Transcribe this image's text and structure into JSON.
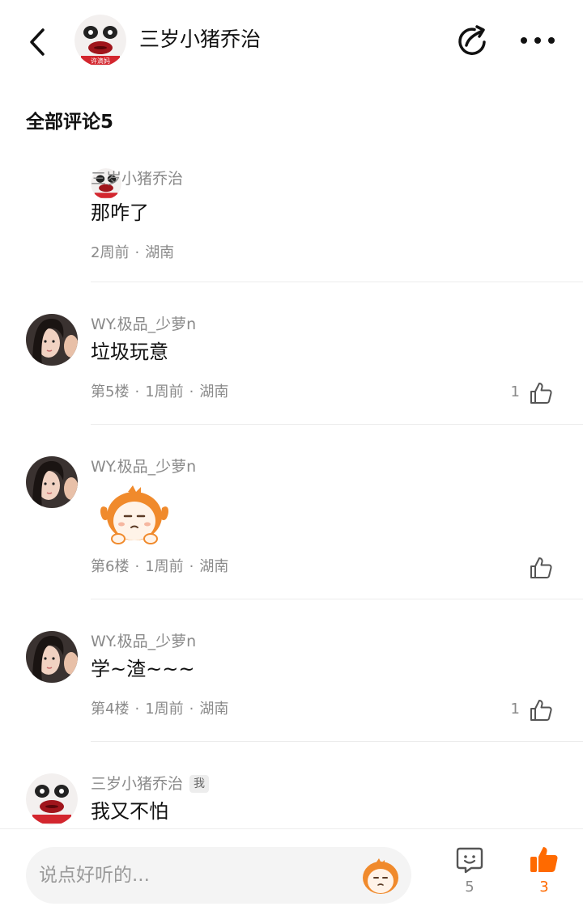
{
  "header": {
    "title": "三岁小猪乔治",
    "avatar_caption": "许滴妈"
  },
  "section": {
    "title": "全部评论5"
  },
  "comments": [
    {
      "name": "三岁小猪乔治",
      "text": "那咋了",
      "time": "2周前",
      "location": "湖南"
    },
    {
      "name": "WY.极品_少萝n",
      "text": "垃圾玩意",
      "floor": "第5楼",
      "time": "1周前",
      "location": "湖南",
      "likes": "1"
    },
    {
      "name": "WY.极品_少萝n",
      "floor": "第6楼",
      "time": "1周前",
      "location": "湖南",
      "sticker": "orange-mascot-sticker"
    },
    {
      "name": "WY.极品_少萝n",
      "text": "学~渣~~~",
      "floor": "第4楼",
      "time": "1周前",
      "location": "湖南",
      "likes": "1"
    },
    {
      "name": "三岁小猪乔治",
      "badge": "我",
      "text": "我又不怕"
    }
  ],
  "meta_separator": "·",
  "bottom": {
    "placeholder": "说点好听的...",
    "comment_count": "5",
    "like_count": "3"
  },
  "colors": {
    "accent": "#ff6a00",
    "muted": "#8a8a8a",
    "divider": "#ececec"
  }
}
